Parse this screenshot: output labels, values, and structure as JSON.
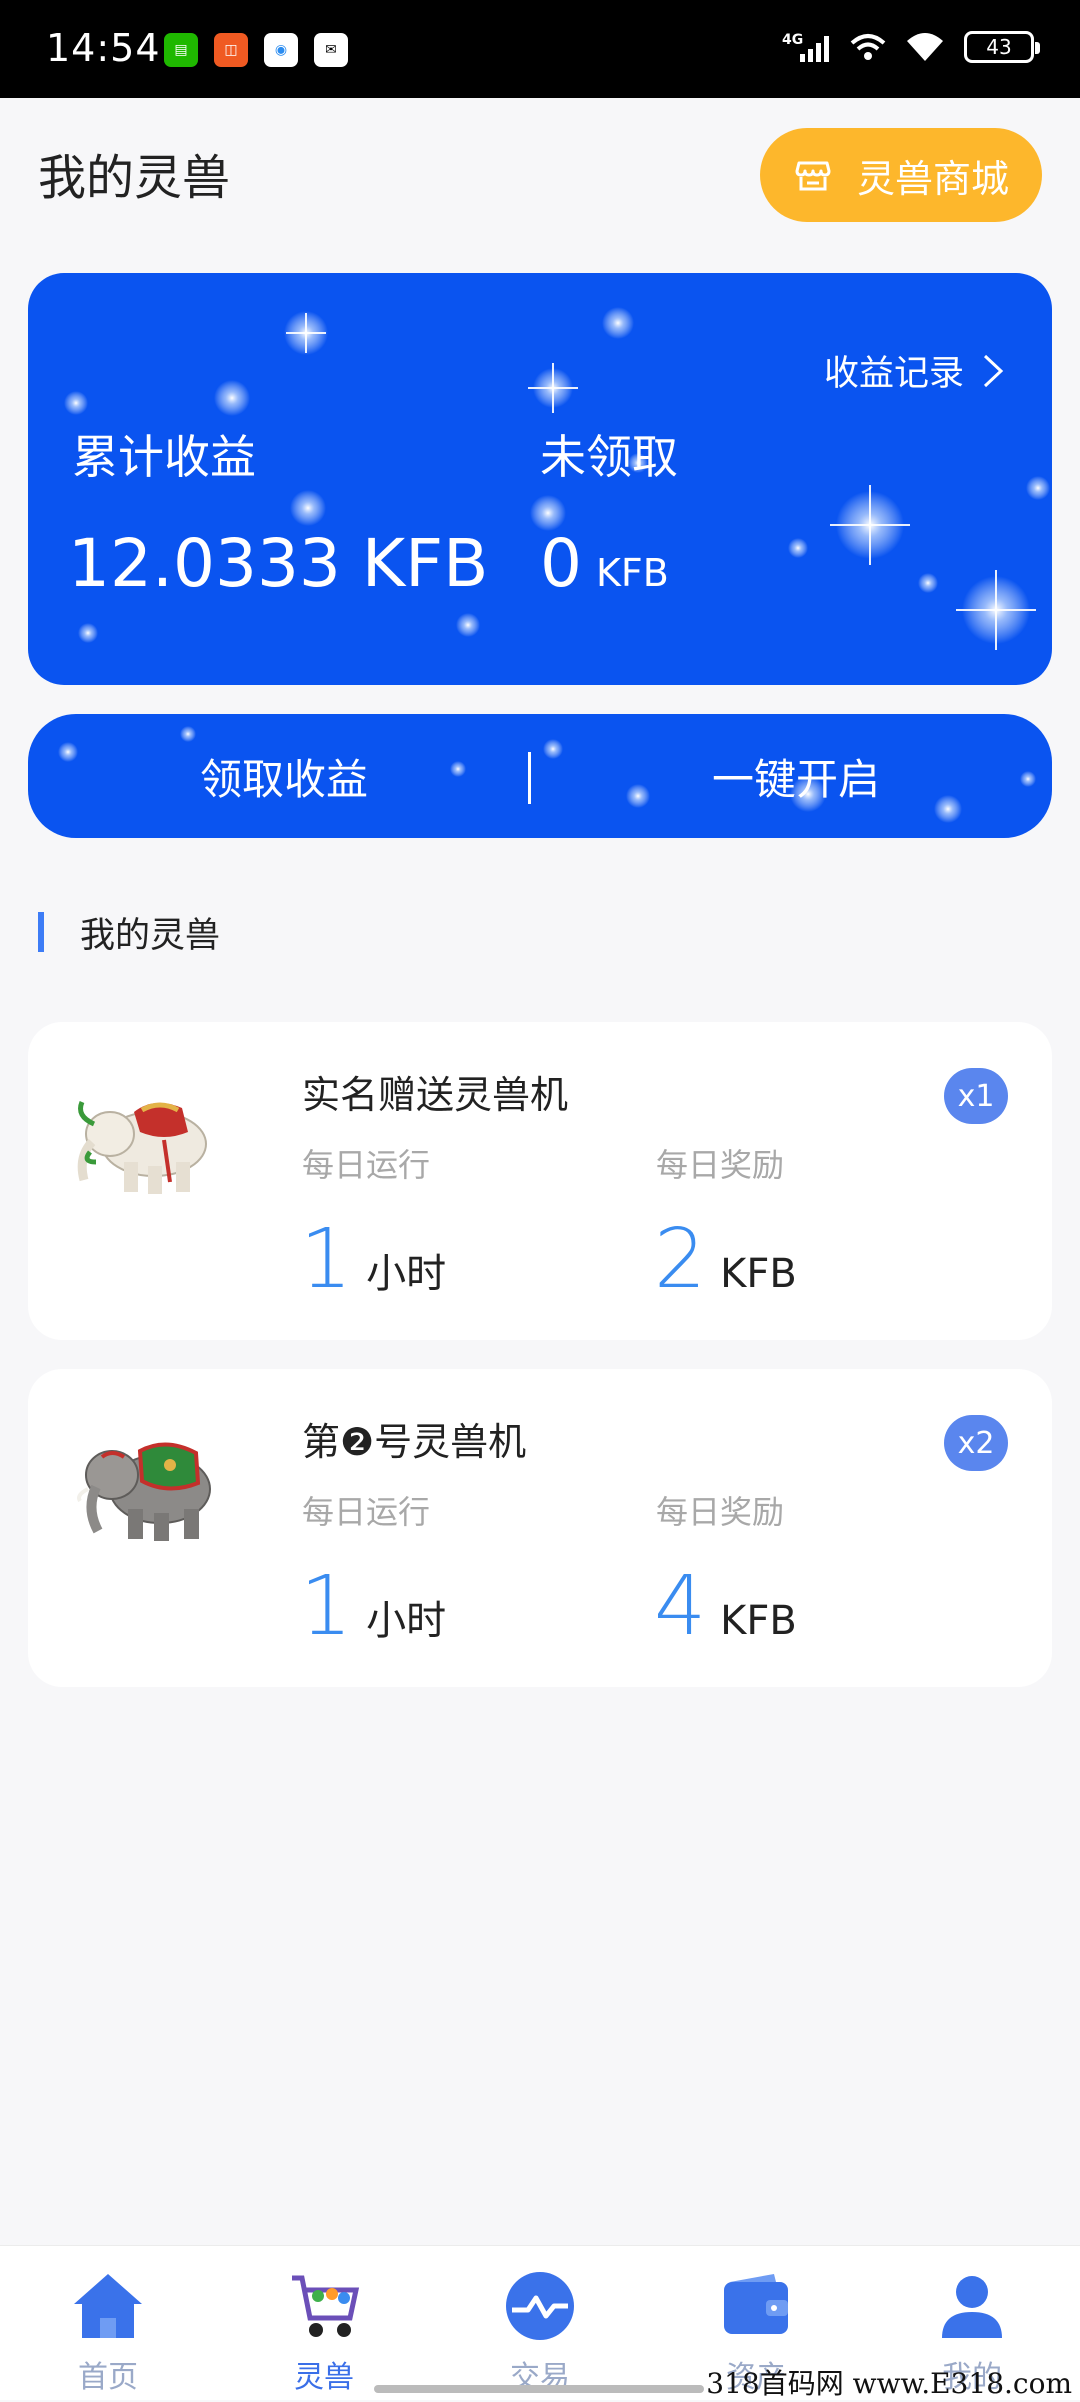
{
  "status_bar": {
    "time": "14:54",
    "network": "4G",
    "battery": "43",
    "apps": [
      "iqiyi-app-icon",
      "mall-app-icon",
      "browser-app-icon",
      "message-app-icon"
    ]
  },
  "header": {
    "title": "我的灵兽",
    "shop_button": "灵兽商城"
  },
  "earnings": {
    "records_link": "收益记录",
    "total_label": "累计收益",
    "total_value": "12.0333 KFB",
    "unclaimed_label": "未领取",
    "unclaimed_value": "0",
    "unclaimed_unit": "KFB"
  },
  "actions": {
    "claim": "领取收益",
    "start_all": "一键开启"
  },
  "section": {
    "title": "我的灵兽"
  },
  "beasts": [
    {
      "name": "实名赠送灵兽机",
      "badge": "x1",
      "run_label": "每日运行",
      "run_value": "1",
      "run_unit": "小时",
      "reward_label": "每日奖励",
      "reward_value": "2",
      "reward_unit": "KFB"
    },
    {
      "name": "第❷号灵兽机",
      "badge": "x2",
      "run_label": "每日运行",
      "run_value": "1",
      "run_unit": "小时",
      "reward_label": "每日奖励",
      "reward_value": "4",
      "reward_unit": "KFB"
    }
  ],
  "tabs": [
    {
      "label": "首页",
      "icon": "home-icon",
      "active": false
    },
    {
      "label": "灵兽",
      "icon": "cart-icon",
      "active": true
    },
    {
      "label": "交易",
      "icon": "trade-icon",
      "active": false
    },
    {
      "label": "资产",
      "icon": "wallet-icon",
      "active": false
    },
    {
      "label": "我的",
      "icon": "user-icon",
      "active": false
    }
  ],
  "watermark": "318首码网 www.E318.com",
  "colors": {
    "brand_blue": "#0a54f0",
    "shop_orange": "#fdb72c",
    "value_blue": "#3a8cf0",
    "badge_blue": "#5a86ee"
  }
}
